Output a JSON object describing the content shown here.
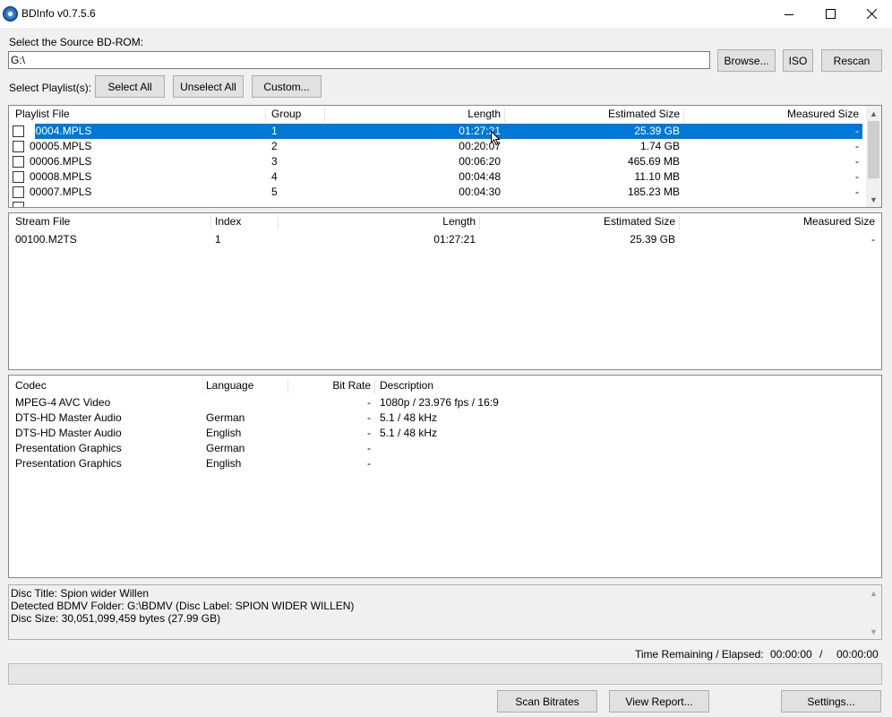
{
  "window": {
    "title": "BDInfo v0.7.5.6"
  },
  "source": {
    "label": "Select the Source BD-ROM:",
    "path": "G:\\"
  },
  "buttons": {
    "browse": "Browse...",
    "iso": "ISO",
    "rescan": "Rescan",
    "select_all": "Select All",
    "unselect_all": "Unselect All",
    "custom": "Custom...",
    "scan_bitrates": "Scan Bitrates",
    "view_report": "View Report...",
    "settings": "Settings..."
  },
  "playlist_label": "Select Playlist(s):",
  "playlists": {
    "columns": [
      "Playlist File",
      "Group",
      "Length",
      "Estimated Size",
      "Measured Size"
    ],
    "rows": [
      {
        "file": "00004.MPLS",
        "group": "1",
        "length": "01:27:21",
        "est": "25.39 GB",
        "meas": "-",
        "selected": true
      },
      {
        "file": "00005.MPLS",
        "group": "2",
        "length": "00:20:07",
        "est": "1.74 GB",
        "meas": "-"
      },
      {
        "file": "00006.MPLS",
        "group": "3",
        "length": "00:06:20",
        "est": "465.69 MB",
        "meas": "-"
      },
      {
        "file": "00008.MPLS",
        "group": "4",
        "length": "00:04:48",
        "est": "11.10 MB",
        "meas": "-"
      },
      {
        "file": "00007.MPLS",
        "group": "5",
        "length": "00:04:30",
        "est": "185.23 MB",
        "meas": "-"
      }
    ]
  },
  "streams": {
    "columns": [
      "Stream File",
      "Index",
      "Length",
      "Estimated Size",
      "Measured Size"
    ],
    "rows": [
      {
        "file": "00100.M2TS",
        "index": "1",
        "length": "01:27:21",
        "est": "25.39 GB",
        "meas": "-"
      }
    ]
  },
  "codecs": {
    "columns": [
      "Codec",
      "Language",
      "Bit Rate",
      "Description"
    ],
    "rows": [
      {
        "codec": "MPEG-4 AVC Video",
        "lang": "",
        "bitrate": "-",
        "desc": "1080p / 23.976 fps / 16:9"
      },
      {
        "codec": "DTS-HD Master Audio",
        "lang": "German",
        "bitrate": "-",
        "desc": "5.1 / 48 kHz"
      },
      {
        "codec": "DTS-HD Master Audio",
        "lang": "English",
        "bitrate": "-",
        "desc": "5.1 / 48 kHz"
      },
      {
        "codec": "Presentation Graphics",
        "lang": "German",
        "bitrate": "-",
        "desc": ""
      },
      {
        "codec": "Presentation Graphics",
        "lang": "English",
        "bitrate": "-",
        "desc": ""
      }
    ]
  },
  "info_lines": [
    "Disc Title: Spion wider Willen",
    "Detected BDMV Folder: G:\\BDMV (Disc Label: SPION WIDER WILLEN)",
    "Disc Size: 30,051,099,459 bytes (27.99 GB)"
  ],
  "time": {
    "label": "Time Remaining / Elapsed:",
    "remaining": "00:00:00",
    "sep": "/",
    "elapsed": "00:00:00"
  },
  "progress": {
    "fraction": 0.0
  },
  "colors": {
    "selection": "#0078d7",
    "button_bg": "#e1e1e1",
    "window_bg": "#f0f0f0"
  }
}
